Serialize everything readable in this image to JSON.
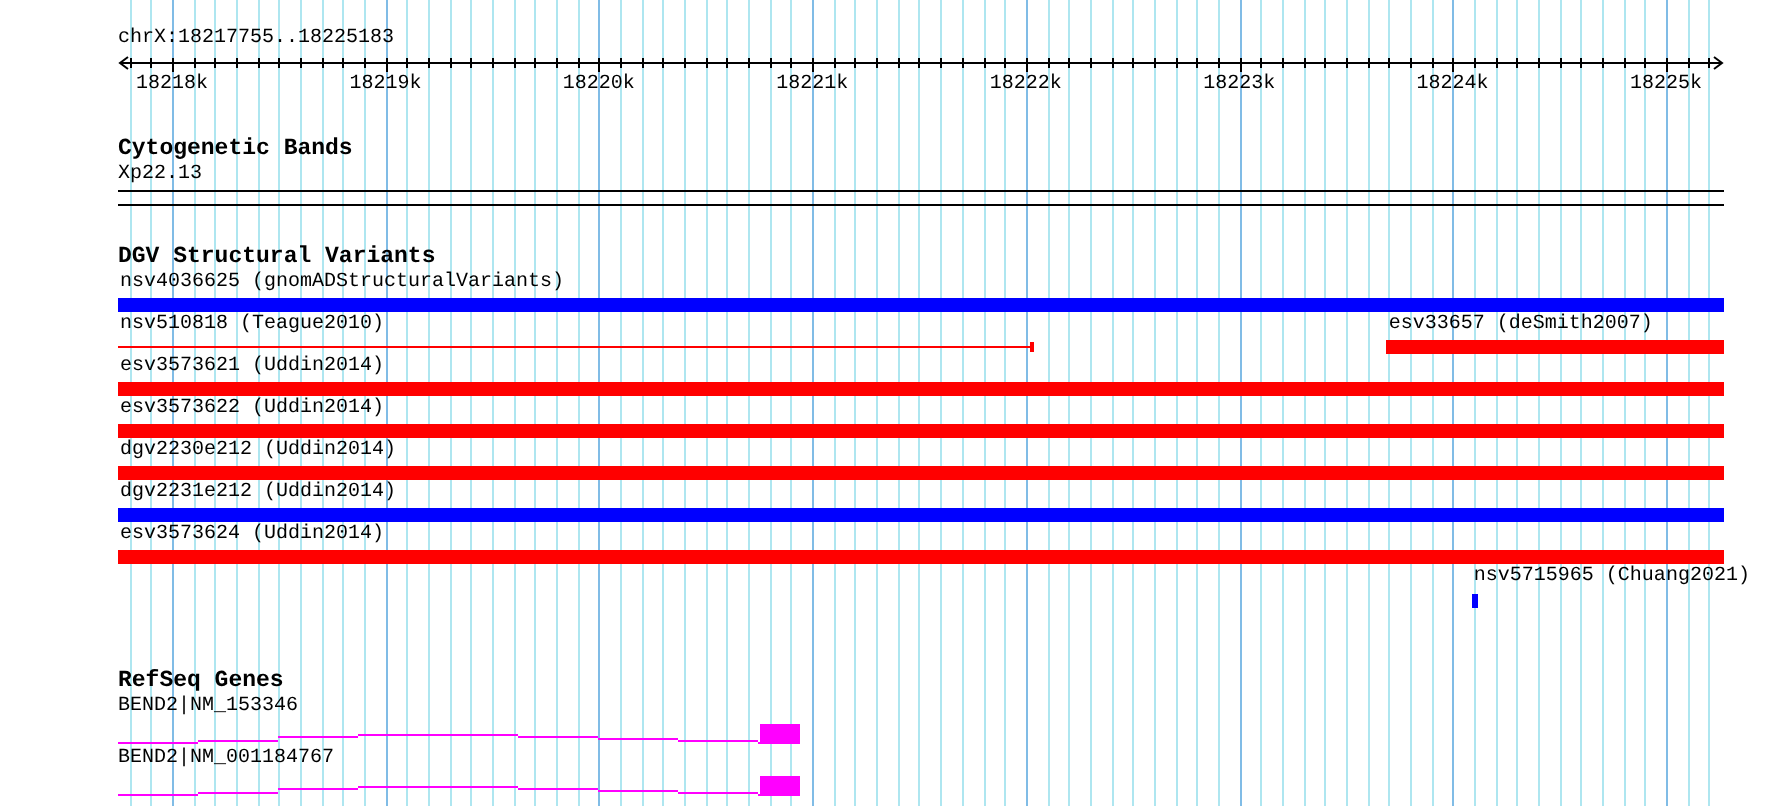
{
  "ruler": {
    "location": "chrX:18217755..18225183",
    "ticks": [
      "18218k",
      "18219k",
      "18220k",
      "18221k",
      "18222k",
      "18223k",
      "18224k",
      "18225k"
    ]
  },
  "tracks": [
    {
      "kind": "bands",
      "title": "Cytogenetic Bands",
      "label": "Xp22.13"
    },
    {
      "kind": "variants",
      "title": "DGV Structural Variants",
      "rows": [
        {
          "features": [
            {
              "label": "nsv4036625 (gnomADStructuralVariants)",
              "color": "#0000ff",
              "kind": "bar"
            }
          ]
        },
        {
          "features": [
            {
              "label": "nsv510818 (Teague2010)",
              "color": "#ff0000",
              "kind": "line"
            },
            {
              "label": "esv33657 (deSmith2007)",
              "color": "#ff0000",
              "kind": "bar-right"
            }
          ]
        },
        {
          "features": [
            {
              "label": "esv3573621 (Uddin2014)",
              "color": "#ff0000",
              "kind": "bar"
            }
          ]
        },
        {
          "features": [
            {
              "label": "esv3573622 (Uddin2014)",
              "color": "#ff0000",
              "kind": "bar"
            }
          ]
        },
        {
          "features": [
            {
              "label": "dgv2230e212 (Uddin2014)",
              "color": "#ff0000",
              "kind": "bar"
            }
          ]
        },
        {
          "features": [
            {
              "label": "dgv2231e212 (Uddin2014)",
              "color": "#0000ff",
              "kind": "bar"
            }
          ]
        },
        {
          "features": [
            {
              "label": "esv3573624 (Uddin2014)",
              "color": "#ff0000",
              "kind": "bar"
            }
          ]
        },
        {
          "features": [
            {
              "label": "nsv5715965 (Chuang2021)",
              "color": "#0000ff",
              "kind": "mark"
            }
          ]
        }
      ]
    },
    {
      "kind": "genes",
      "title": "RefSeq Genes",
      "genes": [
        {
          "label": "BEND2|NM_153346"
        },
        {
          "label": "BEND2|NM_001184767"
        }
      ]
    }
  ]
}
